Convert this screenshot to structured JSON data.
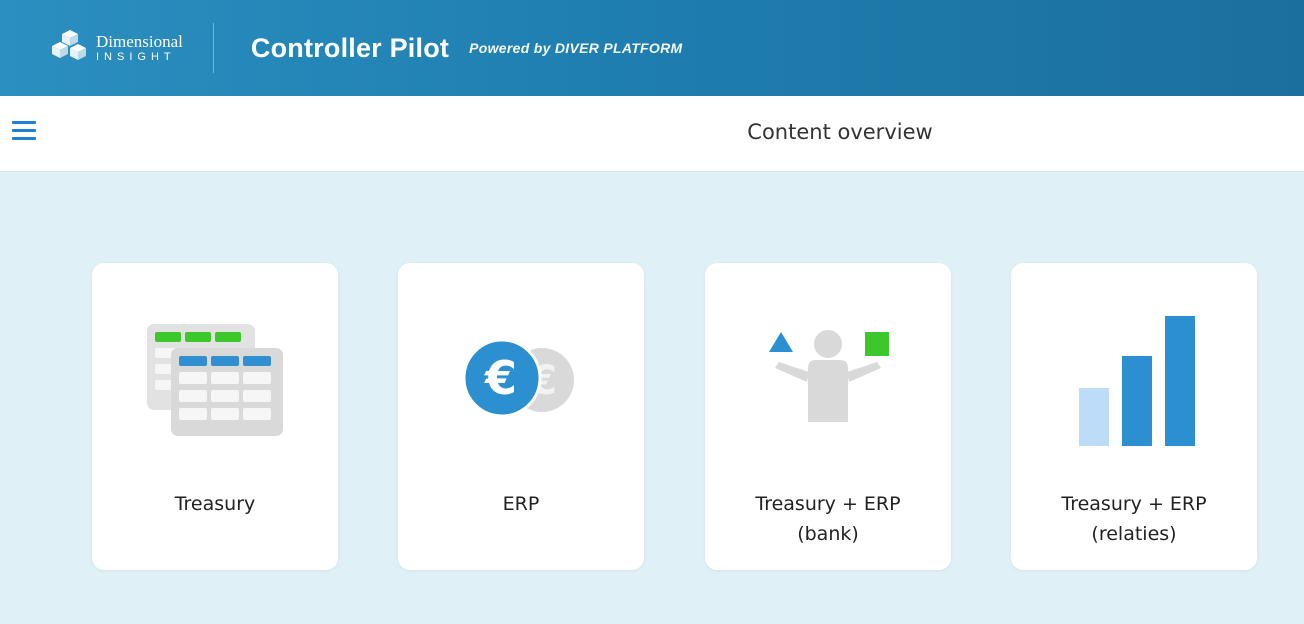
{
  "header": {
    "brand_line1": "Dimensional",
    "brand_line2": "INSIGHT",
    "app_title": "Controller Pilot",
    "powered_by": "Powered by DIVER PLATFORM",
    "colors": {
      "header_bg": "#1f7fb0",
      "page_bg": "#dff0f7",
      "accent": "#1f7fd0"
    }
  },
  "subheader": {
    "menu_icon": "hamburger-menu-icon",
    "title": "Content overview"
  },
  "cards": [
    {
      "label": "Treasury",
      "icon": "spreadsheet-tables-icon"
    },
    {
      "label": "ERP",
      "icon": "euro-coins-icon"
    },
    {
      "label_line1": "Treasury + ERP",
      "label_line2": "(bank)",
      "icon": "balance-person-icon"
    },
    {
      "label_line1": "Treasury + ERP",
      "label_line2": "(relaties)",
      "icon": "bar-chart-icon"
    }
  ]
}
